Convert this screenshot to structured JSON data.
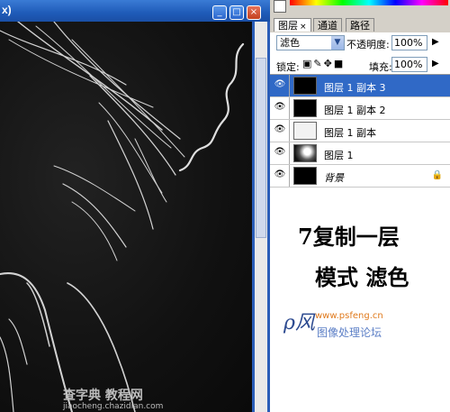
{
  "document": {
    "title_fragment": "x)"
  },
  "panel": {
    "tabs": [
      {
        "label": "图层",
        "active": true
      },
      {
        "label": "通道",
        "active": false
      },
      {
        "label": "路径",
        "active": false
      }
    ],
    "blend_mode": "滤色",
    "opacity_label": "不透明度:",
    "opacity_value": "100%",
    "lock_label": "锁定:",
    "fill_label": "填充:",
    "fill_value": "100%",
    "layers": [
      {
        "name": "图层 1 副本 3",
        "selected": true
      },
      {
        "name": "图层 1 副本 2",
        "selected": false
      },
      {
        "name": "图层 1 副本",
        "selected": false
      },
      {
        "name": "图层 1",
        "selected": false
      },
      {
        "name": "背景",
        "selected": false,
        "locked": true
      }
    ]
  },
  "annotation": {
    "line1": "7复制一层",
    "line2": "模式  滤色"
  },
  "watermark": {
    "site": "www.psfeng.cn",
    "forum": "图像处理论坛",
    "bottom": "查字典 教程网",
    "bottom_site": "jiaocheng.chazidian.com"
  },
  "colors": {
    "selection": "#3069c6",
    "titlebar": "#1f5bb8"
  }
}
